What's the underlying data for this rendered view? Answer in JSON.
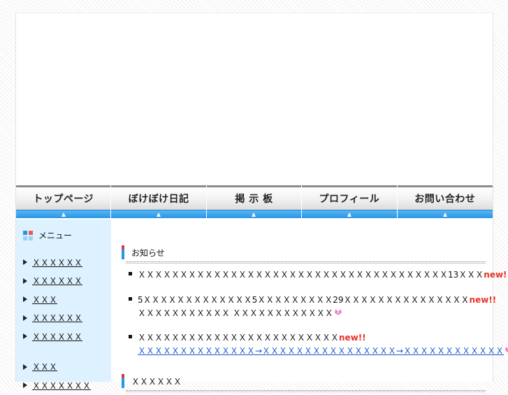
{
  "nav": {
    "items": [
      {
        "label": "トップページ"
      },
      {
        "label": "ぼけぼけ日記"
      },
      {
        "label": "掲 示 板"
      },
      {
        "label": "プロフィール"
      },
      {
        "label": "お問い合わせ"
      }
    ]
  },
  "sidebar": {
    "title": "メニュー",
    "items": [
      {
        "label": "ＸＸＸＸＸＸ"
      },
      {
        "label": "ＸＸＸＸＸＸ"
      },
      {
        "label": "ＸＸＸ"
      },
      {
        "label": "ＸＸＸＸＸＸ"
      },
      {
        "label": "ＸＸＸＸＸＸ"
      },
      {
        "label": "ＸＸＸ"
      },
      {
        "label": "ＸＸＸＸＸＸＸ"
      }
    ]
  },
  "main": {
    "news_title": "お知らせ",
    "news": [
      {
        "line1": "ＸＸＸＸＸＸＸＸＸＸＸＸＸＸＸＸＸＸＸＸＸＸＸＸＸＸＸＸＸＸＸＸＸＸＸＸＸ13ＸＸＸ",
        "new_label": "new!!"
      },
      {
        "line1": "5ＸＸＸＸＸＸＸＸＸＸＸＸＸ5ＸＸＸＸＸＸＸＸＸ29ＸＸＸＸＸＸＸＸＸＸＸＸＸＸＸ",
        "new_label": "new!!",
        "line2": "ＸＸＸＸＸＸＸＸＸＸＸ ＸＸＸＸＸＸＸＸＸＸＸＸ"
      },
      {
        "line1": "ＸＸＸＸＸＸＸＸＸＸＸＸＸＸＸＸＸＸＸＸＸＸＸＸ",
        "new_label": "new!!",
        "link": "ＸＸＸＸＸＸＸＸＸＸＸＸＸＸ→ＸＸＸＸＸＸＸＸＸＸＸＸＸＸＸＸ→ＸＸＸＸＸＸＸＸＸＸＸＸ"
      }
    ],
    "section2_title": "ＸＸＸＸＸＸ"
  },
  "colors": {
    "accent_blue": "#2795e6",
    "accent_red": "#e8322a",
    "sidebar_bg": "#ddf1fe"
  }
}
